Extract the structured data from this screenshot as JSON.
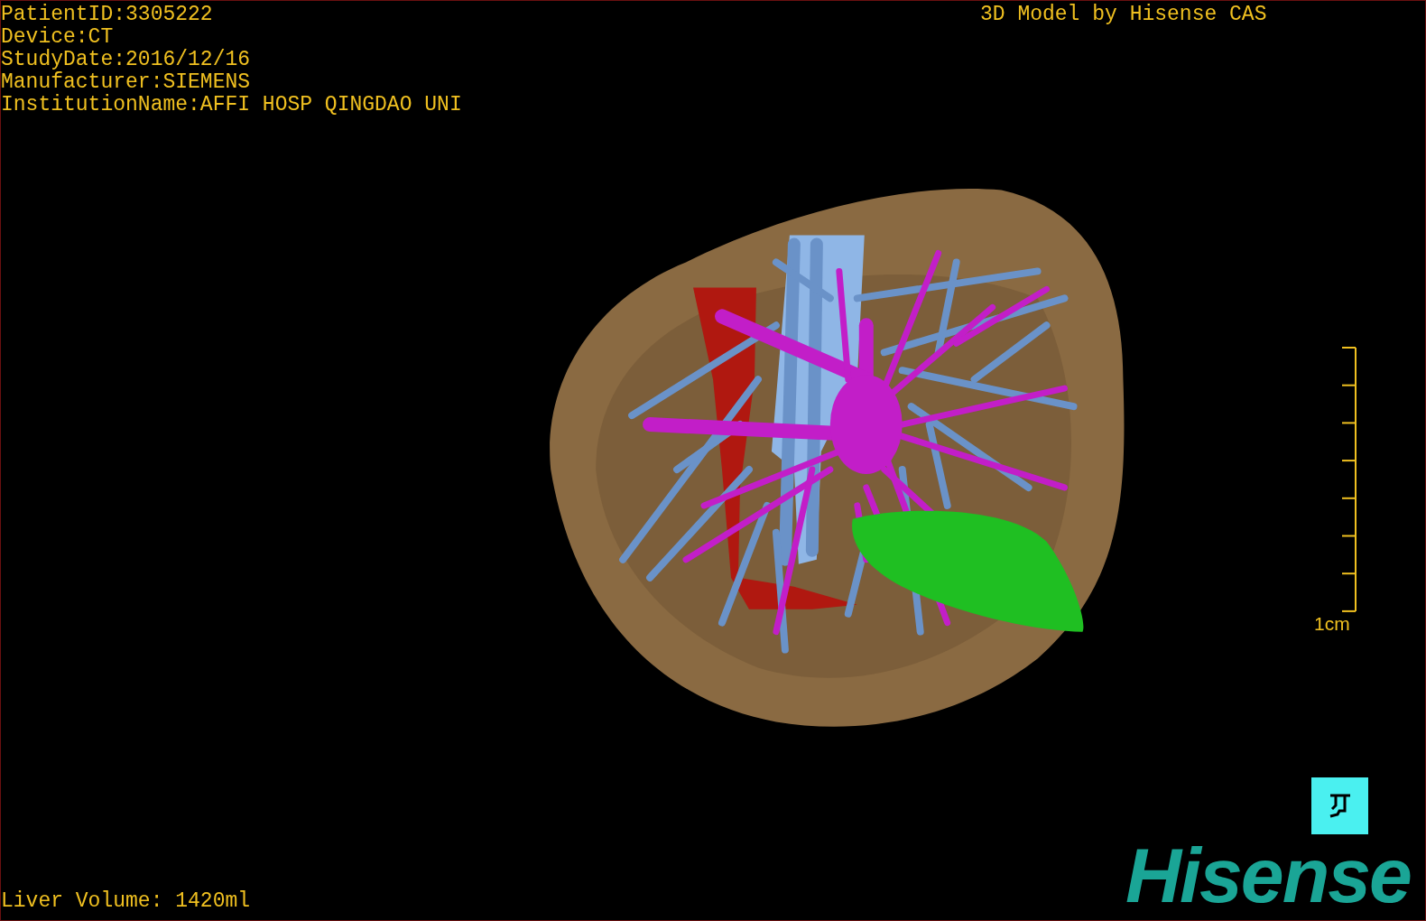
{
  "patient_info": [
    "PatientID:3305222",
    "Device:CT",
    "StudyDate:2016/12/16",
    "Manufacturer:SIEMENS",
    "InstitutionName:AFFI HOSP QINGDAO UNI"
  ],
  "title": "3D Model by Hisense CAS",
  "scale_bar": {
    "label": "1cm"
  },
  "liver_volume": "Liver Volume: 1420ml",
  "logo": "Hisense"
}
